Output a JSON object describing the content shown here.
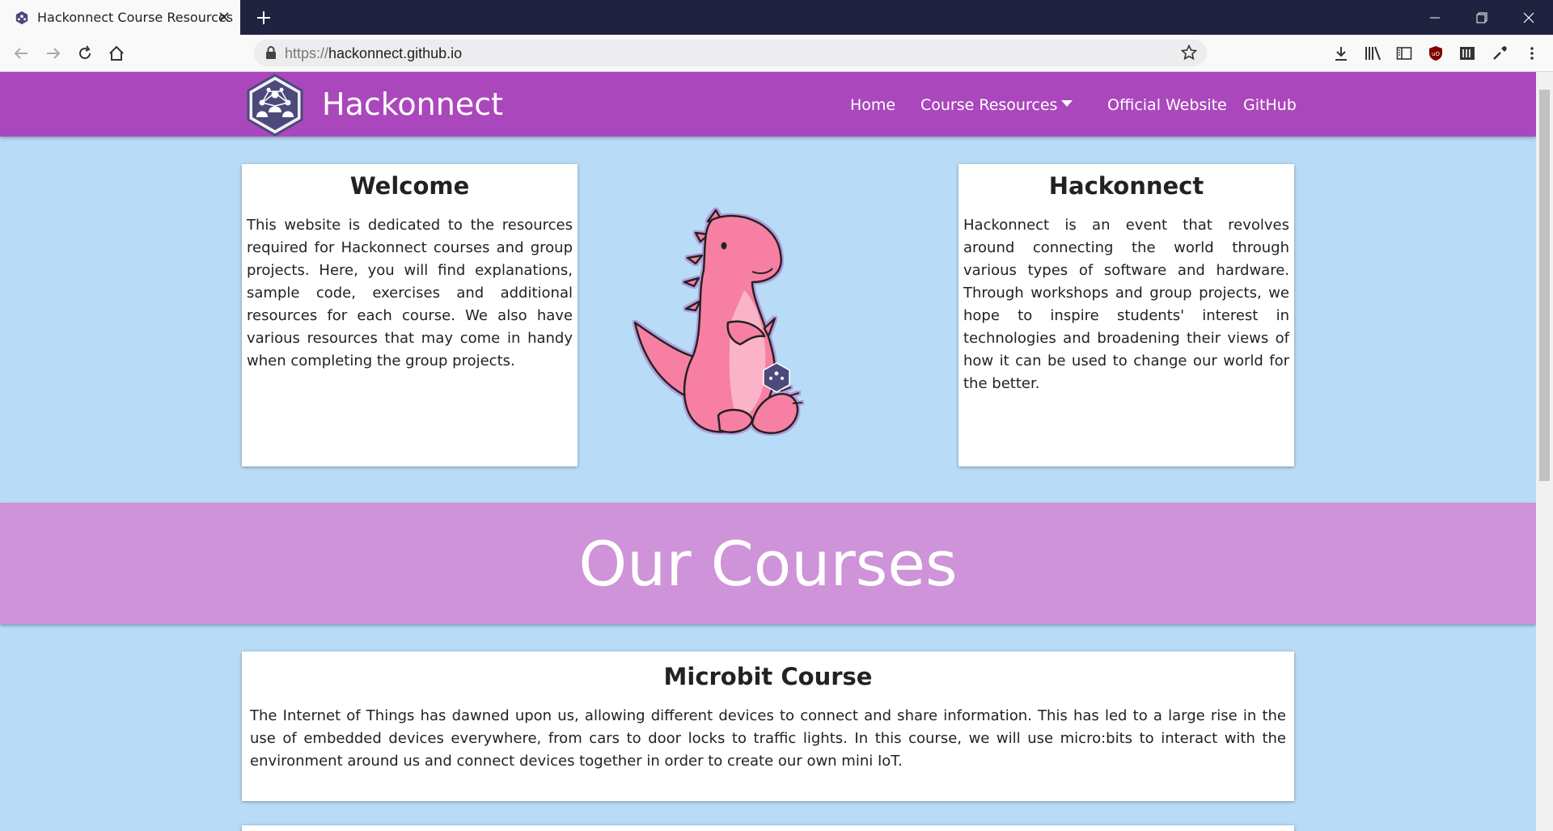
{
  "browser": {
    "tab_title": "Hackonnect Course Resources",
    "url_scheme": "https://",
    "url_host": "hackonnect.github.io"
  },
  "header": {
    "brand": "Hackonnect",
    "menu": {
      "home": "Home",
      "course_resources": "Course Resources",
      "official_website": "Official Website",
      "github": "GitHub"
    }
  },
  "welcome": {
    "title": "Welcome",
    "body": "This website is dedicated to the resources required for Hackonnect courses and group projects. Here, you will find explanations, sample code, exercises and additional resources for each course. We also have various resources that may come in handy when completing the group projects."
  },
  "about": {
    "title": "Hackonnect",
    "body": "Hackonnect is an event that revolves around connecting the world through various types of software and hardware. Through workshops and group projects, we hope to inspire students' interest in technologies and broadening their views of how it can be used to change our world for the better."
  },
  "courses": {
    "title": "Our Courses",
    "items": [
      {
        "title": "Microbit Course",
        "body": "The Internet of Things has dawned upon us, allowing different devices to connect and share information. This has led to a large rise in the use of embedded devices everywhere, from cars to door locks to traffic lights. In this course, we will use micro:bits to interact with the environment around us and connect devices together in order to create our own mini IoT."
      }
    ]
  },
  "colors": {
    "header": "#ab47bc",
    "banner": "#ce93d8",
    "page_bg": "#b8dcf7",
    "mascot": "#f77fa3"
  },
  "icons": [
    "hackonnect-favicon",
    "close-icon",
    "plus-icon",
    "minimize-icon",
    "restore-icon",
    "window-close-icon",
    "back-icon",
    "forward-icon",
    "reload-icon",
    "home-icon",
    "lock-icon",
    "bookmark-star-icon",
    "download-icon",
    "library-icon",
    "sidebar-icon",
    "ublock-icon",
    "reader-icon",
    "eyedropper-icon",
    "menu-icon",
    "hackonnect-logo",
    "dino-mascot"
  ]
}
